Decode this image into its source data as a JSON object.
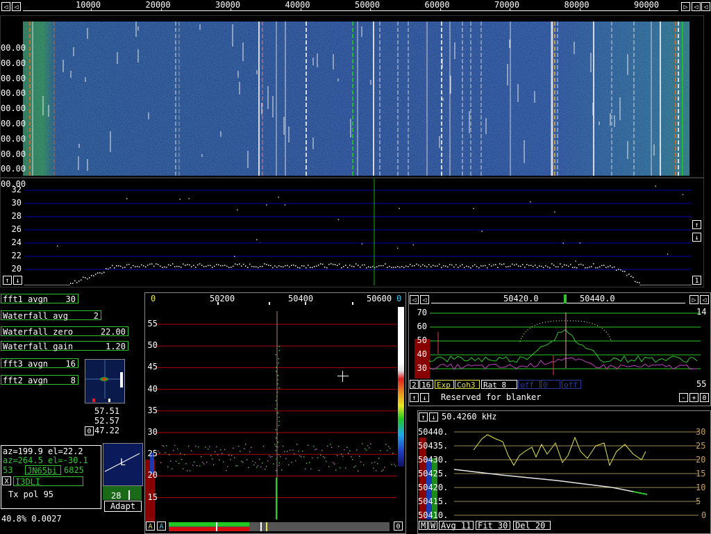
{
  "freq_axis": {
    "ticks": [
      "10000",
      "20000",
      "30000",
      "40000",
      "50000",
      "60000",
      "70000",
      "80000",
      "90000"
    ]
  },
  "waterfall": {
    "time_labels": [
      "00.00",
      "00.00",
      "00.00",
      "00.00",
      "00.00",
      "00.00",
      "00.00",
      "00.00",
      "00.00",
      "00.00"
    ]
  },
  "spectrum1": {
    "y_labels": [
      "32",
      "30",
      "28",
      "26",
      "24",
      "22",
      "20"
    ],
    "right_btn": "1"
  },
  "controls": {
    "fft1_label": "fft1 avgn",
    "fft1_value": "30",
    "wf_avg_label": "Waterfall avg",
    "wf_avg_value": "2",
    "wf_zero_label": "Waterfall zero",
    "wf_zero_value": "22.00",
    "wf_gain_label": "Waterfall gain",
    "wf_gain_value": "1.20",
    "fft3_label": "fft3 avgn",
    "fft3_value": "16",
    "fft2_label": "fft2 avgn",
    "fft2_value": "8"
  },
  "small_readout": {
    "v1": "57.51",
    "v2": "52.57",
    "v3": "47.22",
    "btn": "0"
  },
  "station": {
    "line1": "az=199.9 el=22.2",
    "line2": "az=264.5 el=-30.1",
    "num": "53",
    "locator": "JN65bi",
    "dist": "6825",
    "x_btn": "X",
    "call": "I3DLI",
    "txpol": "Tx pol 95",
    "status": "40.8% 0.0027"
  },
  "pol": {
    "letter": "L",
    "value": "28",
    "adapt": "Adapt"
  },
  "baseband": {
    "freq_ticks": [
      "50200",
      "50400",
      "50600"
    ],
    "left_zero": "0",
    "right_zero": "0",
    "y_labels": [
      "55",
      "50",
      "45",
      "40",
      "35",
      "30",
      "25",
      "20",
      "15"
    ],
    "a1": "A",
    "a2": "A",
    "bottom_zero": "0"
  },
  "hires": {
    "freq_ticks": [
      "50420.0",
      "50440.0"
    ],
    "right_num": "14",
    "y_labels": [
      "70",
      "60",
      "50",
      "40",
      "30"
    ],
    "controls": [
      "2",
      "16",
      "Exp",
      "Coh3",
      "Rat  8",
      "off",
      "0",
      "off"
    ],
    "right_value": "55",
    "blanker_text": "Reserved for blanker",
    "btn_minus": "-",
    "btn_plus": "+",
    "btn_zero": "0"
  },
  "freqtrack": {
    "title": "50.4260 kHz",
    "left_labels": [
      "50440.",
      "50435.",
      "50430.",
      "50425.",
      "50420.",
      "50415.",
      "50410."
    ],
    "right_labels": [
      "30",
      "25",
      "20",
      "15",
      "10",
      "5",
      "0"
    ],
    "bottom": [
      "M",
      "W",
      "Avg 11",
      "Fit 30",
      "Del 20"
    ]
  },
  "colors": {
    "green": "#2ec82e",
    "blue_grid": "#0000b4",
    "red_grid": "#b40000",
    "yellow": "#e8e84a"
  }
}
